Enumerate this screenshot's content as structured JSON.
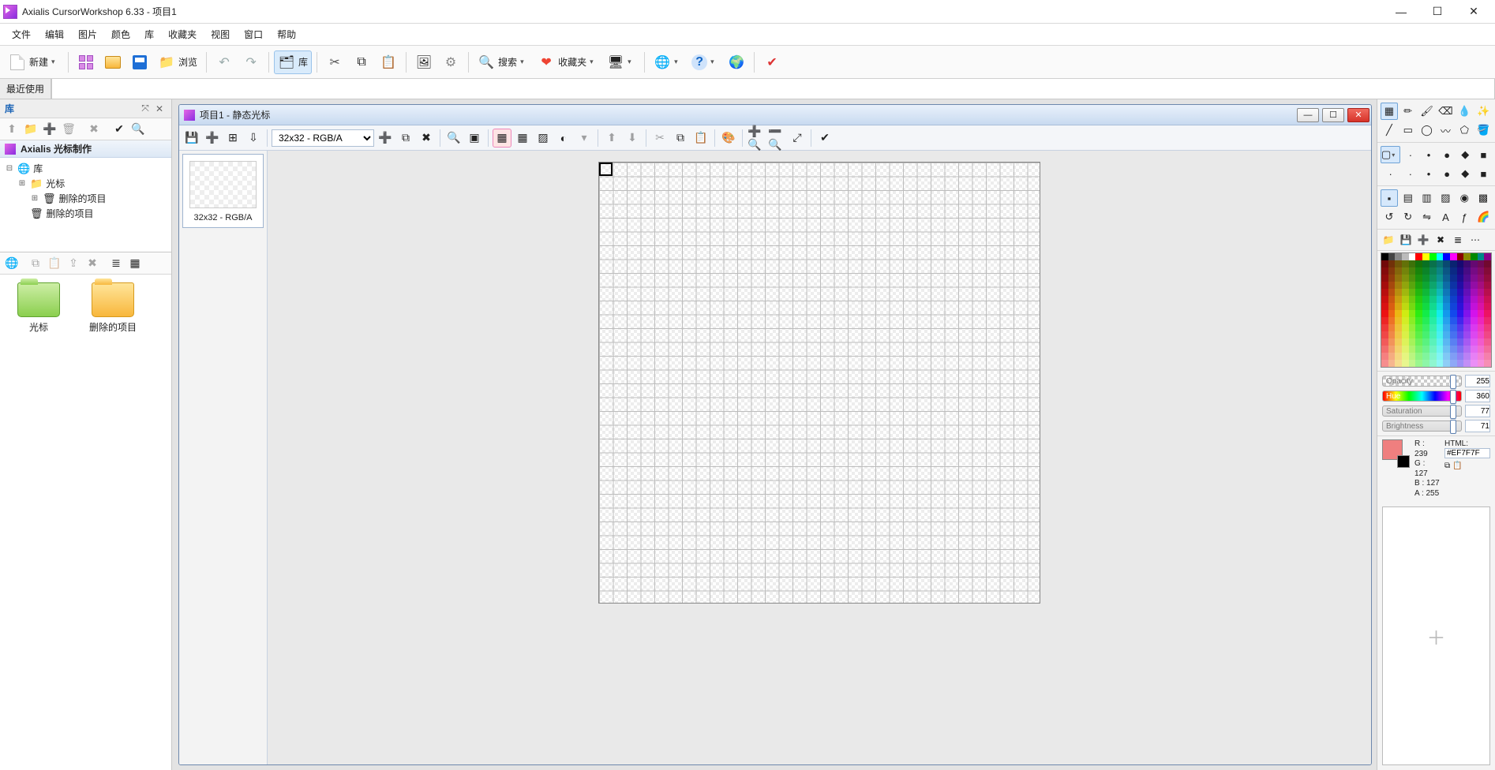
{
  "app": {
    "title": "Axialis CursorWorkshop 6.33 - 项目1"
  },
  "menu": {
    "file": "文件",
    "edit": "编辑",
    "image": "图片",
    "color": "颜色",
    "library": "库",
    "favorites": "收藏夹",
    "view": "视图",
    "window": "窗口",
    "help": "帮助"
  },
  "toolbar": {
    "new": "新建",
    "browse": "浏览",
    "library": "库",
    "search": "搜索",
    "favorites": "收藏夹"
  },
  "recent": {
    "label": "最近使用",
    "value": ""
  },
  "library": {
    "title": "库",
    "tree_head": "Axialis 光标制作",
    "root": "库",
    "nodes": {
      "cursors": "光标",
      "deleted": "删除的项目",
      "deleted2": "删除的项目"
    },
    "folders": {
      "cursors": "光标",
      "deleted": "删除的项目"
    }
  },
  "doc": {
    "title": "项目1 - 静态光标",
    "format_select": "32x32 - RGB/A",
    "format_label": "32x32 - RGB/A"
  },
  "color": {
    "opacity_label": "Opacity",
    "opacity": "255",
    "hue_label": "Hue",
    "hue": "360",
    "sat_label": "Saturation",
    "sat": "77",
    "bri_label": "Brightness",
    "bri": "71",
    "r": "R : 239",
    "g": "G : 127",
    "b": "B : 127",
    "a": "A : 255",
    "html_label": "HTML:",
    "html": "#EF7F7F"
  }
}
